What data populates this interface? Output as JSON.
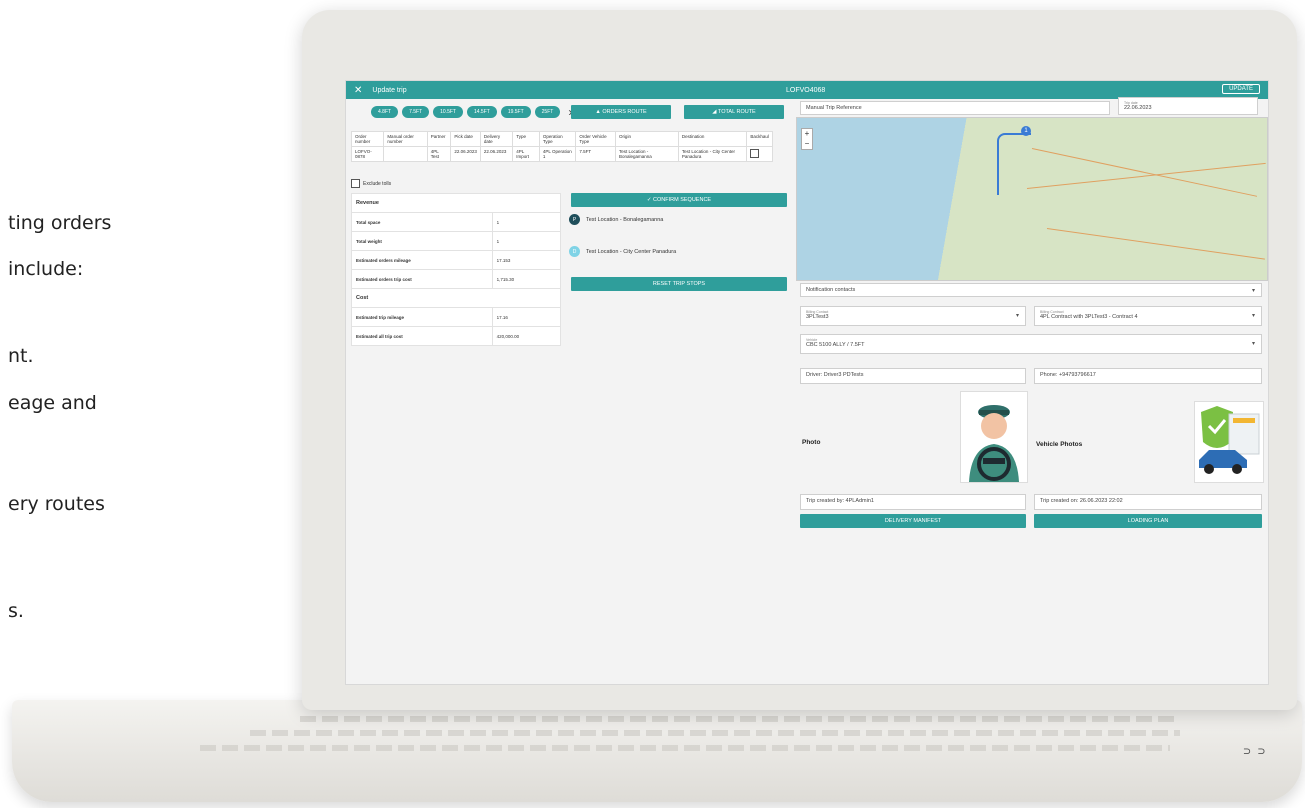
{
  "side_text": [
    "ting orders",
    "include:",
    "nt.",
    "eage and",
    "ery routes",
    "s."
  ],
  "app": {
    "title": "Update trip",
    "order_id": "LOFVO4068",
    "update_label": "UPDATE",
    "close_glyph": "✕"
  },
  "chips": [
    "4.8FT",
    "7.5FT",
    "10.5FT",
    "14.5FT",
    "19.5FT",
    "25FT"
  ],
  "buttons": {
    "orders_route": "ORDERS ROUTE",
    "total_route": "TOTAL ROUTE",
    "confirm_sequence": "CONFIRM SEQUENCE",
    "reset_trip_stops": "RESET TRIP STOPS",
    "delivery_manifest": "DELIVERY MANIFEST",
    "loading_plan": "LOADING PLAN"
  },
  "orders_table": {
    "headers": [
      "Order number",
      "Manual order number",
      "Partner",
      "Pick date",
      "Delivery date",
      "Type",
      "Operation Type",
      "Order Vehicle Type",
      "Origin",
      "Destination",
      "Backhaul"
    ],
    "rows": [
      [
        "LOFVO-0878",
        "",
        "4PL Test",
        "22.06.2023",
        "22.06.2023",
        "4PL Import",
        "4PL Operation 1",
        "7.5FT",
        "Test Location - Bonalegamanna",
        "Test Location - City Center Panadura",
        ""
      ]
    ]
  },
  "exclude_tolls": "Exclude tolls",
  "summary": {
    "revenue_header": "Revenue",
    "cost_header": "Cost",
    "rows_revenue": [
      {
        "label": "Total space",
        "value": "1"
      },
      {
        "label": "Total weight",
        "value": "1"
      },
      {
        "label": "Estimated orders mileage",
        "value": "17.153"
      },
      {
        "label": "Estimated orders trip cost",
        "value": "1,715.30"
      }
    ],
    "rows_cost": [
      {
        "label": "Estimated trip mileage",
        "value": "17.16"
      },
      {
        "label": "Estimated all trip cost",
        "value": "420,000.00"
      }
    ]
  },
  "sequence": [
    {
      "marker": "P",
      "label": "Test Location - Bonalegamanna"
    },
    {
      "marker": "D",
      "label": "Test Location - City Center Panadura"
    }
  ],
  "form": {
    "trip_reference_placeholder": "Manual Trip Reference",
    "trip_date_label": "Trip date",
    "trip_date": "22.06.2023",
    "notification_contacts": "Notification contacts",
    "billing_contact_label": "Billing Contact",
    "billing_contact": "3PLTest3",
    "billing_contract_label": "Billing Contract",
    "billing_contract": "4PL Contract with 3PLTest3 - Contract 4",
    "vehicle_label": "Vehicle",
    "vehicle": "CBC 5100 ALLY / 7.5FT",
    "driver": "Driver: Driver3 PDTests",
    "phone": "Phone: +94793796617",
    "photo_label": "Photo",
    "vehicle_photos_label": "Vehicle Photos",
    "created_by": "Trip created by: 4PLAdmin1",
    "created_on": "Trip created on: 26.06.2023 22:02"
  },
  "map": {
    "pin": "1"
  },
  "base": {
    "ports": "⊃ ⊃"
  },
  "colors": {
    "accent": "#2f9e9b",
    "dark_marker": "#1f4e5a",
    "light_marker": "#7fd3e6"
  },
  "icons": [
    "close-icon",
    "chevron-right-icon",
    "route-icon",
    "check-icon",
    "dropdown-icon",
    "zoom-in-icon",
    "zoom-out-icon",
    "driver-photo",
    "vehicle-photo"
  ]
}
